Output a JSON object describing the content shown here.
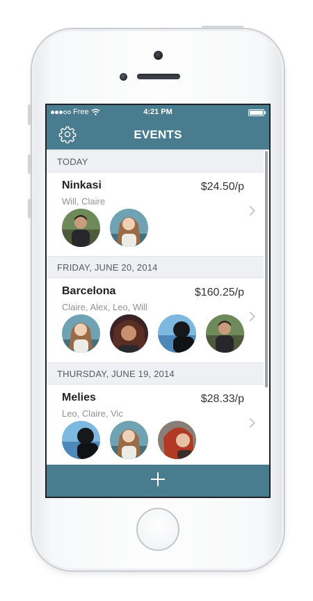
{
  "status_bar": {
    "carrier": "Free",
    "time": "4:21 PM"
  },
  "header": {
    "title": "EVENTS"
  },
  "sections": [
    {
      "label": "TODAY",
      "event": {
        "name": "Ninkasi",
        "people": "Will, Claire",
        "price": "$24.50/p"
      }
    },
    {
      "label": "FRIDAY, JUNE 20, 2014",
      "event": {
        "name": "Barcelona",
        "people": "Claire, Alex, Leo, Will",
        "price": "$160.25/p"
      }
    },
    {
      "label": "THURSDAY, JUNE 19, 2014",
      "event": {
        "name": "Melies",
        "people": "Leo, Claire, Vic",
        "price": "$28.33/p"
      }
    }
  ],
  "colors": {
    "accent": "#4a7c8f",
    "section_bg": "#eef0f3"
  },
  "icons": {
    "settings": "gear-icon",
    "add": "plus-icon",
    "disclosure": "chevron-right-icon"
  }
}
